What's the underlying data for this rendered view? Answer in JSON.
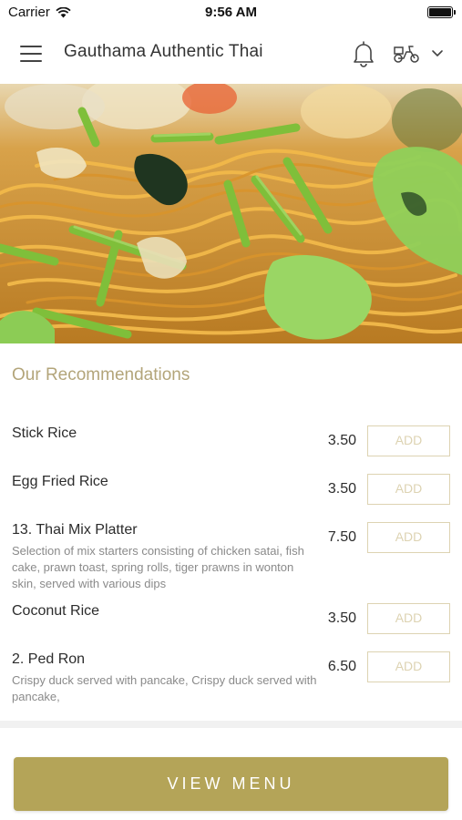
{
  "status_bar": {
    "carrier": "Carrier",
    "time": "9:56 AM"
  },
  "header": {
    "title": "Gauthama Authentic Thai",
    "icons": [
      "menu-icon",
      "bell-icon",
      "scooter-icon",
      "chevron-down-icon"
    ]
  },
  "recommendations": {
    "title": "Our Recommendations",
    "add_label": "ADD",
    "items": [
      {
        "name": "Stick Rice",
        "price": "3.50",
        "description": ""
      },
      {
        "name": "Egg Fried Rice",
        "price": "3.50",
        "description": ""
      },
      {
        "name": "13. Thai Mix Platter",
        "price": "7.50",
        "description": "Selection of mix starters consisting of chicken satai, fish cake, prawn toast, spring rolls, tiger prawns in wonton skin, served with various dips"
      },
      {
        "name": "Coconut Rice",
        "price": "3.50",
        "description": ""
      },
      {
        "name": "2. Ped Ron",
        "price": "6.50",
        "description": "Crispy duck served with pancake, Crispy duck served with pancake,"
      }
    ]
  },
  "footer": {
    "view_menu_label": "VIEW MENU"
  },
  "colors": {
    "accent": "#b4a458",
    "section_title": "#b3a57a",
    "add_border": "#ddd3b2"
  }
}
